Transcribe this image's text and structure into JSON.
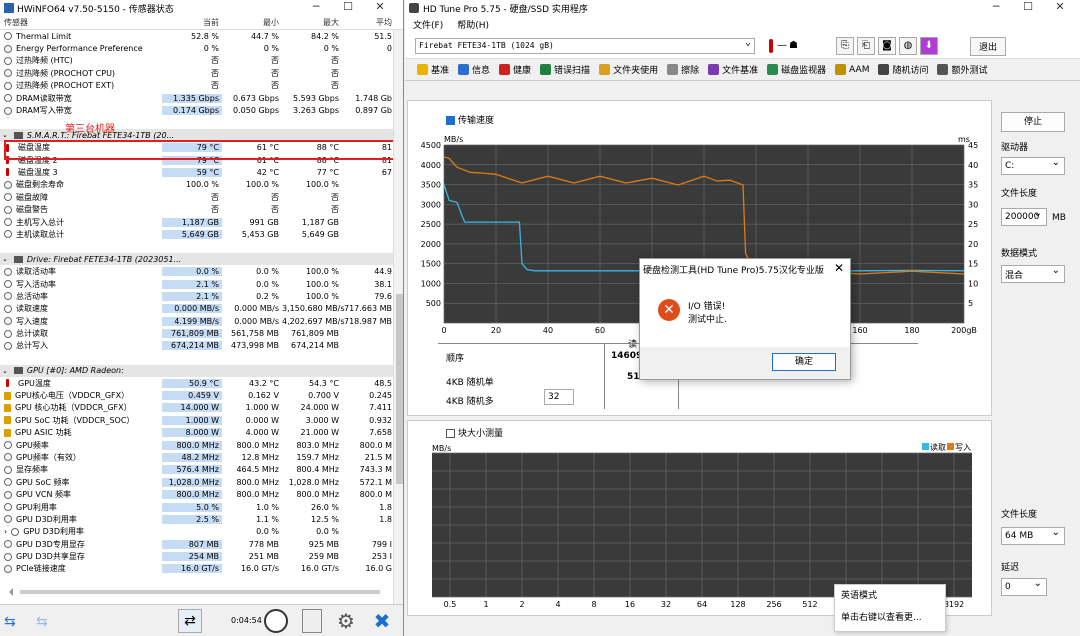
{
  "hwinfo": {
    "title": "HWiNFO64 v7.50-5150 - 传感器状态",
    "headers": [
      "传感器",
      "当前",
      "最小",
      "最大",
      "平均"
    ],
    "annotation": "第三台机器",
    "rows": [
      {
        "k": "r",
        "icon": "ic",
        "name": "Thermal Limit",
        "v": [
          "52.8 %",
          "44.7 %",
          "84.2 %",
          "51.5"
        ]
      },
      {
        "k": "r",
        "icon": "ic",
        "name": "Energy Performance Preference",
        "v": [
          "0 %",
          "0 %",
          "0 %",
          "0"
        ]
      },
      {
        "k": "r",
        "icon": "ic",
        "name": "过热降频 (HTC)",
        "v": [
          "否",
          "否",
          "否",
          ""
        ]
      },
      {
        "k": "r",
        "icon": "ic",
        "name": "过热降频 (PROCHOT CPU)",
        "v": [
          "否",
          "否",
          "否",
          ""
        ]
      },
      {
        "k": "r",
        "icon": "ic",
        "name": "过热降频 (PROCHOT EXT)",
        "v": [
          "否",
          "否",
          "否",
          ""
        ]
      },
      {
        "k": "r",
        "icon": "ic",
        "name": "DRAM读取带宽",
        "v": [
          "1.335 Gbps",
          "0.673 Gbps",
          "5.593 Gbps",
          "1.748 Gb"
        ],
        "hl": true
      },
      {
        "k": "r",
        "icon": "ic",
        "name": "DRAM写入带宽",
        "v": [
          "0.174 Gbps",
          "0.050 Gbps",
          "3.263 Gbps",
          "0.897 Gb"
        ],
        "hl": true
      },
      {
        "k": "s"
      },
      {
        "k": "g",
        "name": "S.M.A.R.T.: Firebat FETE34-1TB (20..."
      },
      {
        "k": "r",
        "icon": "t",
        "name": "磁盘温度",
        "v": [
          "79 °C",
          "61 °C",
          "88 °C",
          "81"
        ],
        "hl": true
      },
      {
        "k": "r",
        "icon": "t",
        "name": "磁盘温度 2",
        "v": [
          "79 °C",
          "61 °C",
          "88 °C",
          "81"
        ],
        "hl": true
      },
      {
        "k": "r",
        "icon": "t",
        "name": "磁盘温度 3",
        "v": [
          "59 °C",
          "42 °C",
          "77 °C",
          "67"
        ],
        "hl": true
      },
      {
        "k": "r",
        "icon": "ic",
        "name": "磁盘剩余寿命",
        "v": [
          "100.0 %",
          "100.0 %",
          "100.0 %",
          ""
        ]
      },
      {
        "k": "r",
        "icon": "ic",
        "name": "磁盘故障",
        "v": [
          "否",
          "否",
          "否",
          ""
        ]
      },
      {
        "k": "r",
        "icon": "ic",
        "name": "磁盘警告",
        "v": [
          "否",
          "否",
          "否",
          ""
        ]
      },
      {
        "k": "r",
        "icon": "ic",
        "name": "主机写入总计",
        "v": [
          "1,187 GB",
          "991 GB",
          "1,187 GB",
          ""
        ],
        "hl": true
      },
      {
        "k": "r",
        "icon": "ic",
        "name": "主机读取总计",
        "v": [
          "5,649 GB",
          "5,453 GB",
          "5,649 GB",
          ""
        ],
        "hl": true
      },
      {
        "k": "s"
      },
      {
        "k": "g",
        "name": "Drive: Firebat FETE34-1TB (2023051..."
      },
      {
        "k": "r",
        "icon": "ic",
        "name": "读取活动率",
        "v": [
          "0.0 %",
          "0.0 %",
          "100.0 %",
          "44.9"
        ],
        "hl": true
      },
      {
        "k": "r",
        "icon": "ic",
        "name": "写入活动率",
        "v": [
          "2.1 %",
          "0.0 %",
          "100.0 %",
          "38.1"
        ],
        "hl": true
      },
      {
        "k": "r",
        "icon": "ic",
        "name": "总活动率",
        "v": [
          "2.1 %",
          "0.2 %",
          "100.0 %",
          "79.6"
        ],
        "hl": true
      },
      {
        "k": "r",
        "icon": "ic",
        "name": "读取速度",
        "v": [
          "0.000 MB/s",
          "0.000 MB/s",
          "3,150.680 MB/s",
          "717.663 MB"
        ],
        "hl": true
      },
      {
        "k": "r",
        "icon": "ic",
        "name": "写入速度",
        "v": [
          "4.199 MB/s",
          "0.000 MB/s",
          "4,202.697 MB/s",
          "718.987 MB"
        ],
        "hl": true
      },
      {
        "k": "r",
        "icon": "ic",
        "name": "总计读取",
        "v": [
          "761,809 MB",
          "561,758 MB",
          "761,809 MB",
          ""
        ],
        "hl": true
      },
      {
        "k": "r",
        "icon": "ic",
        "name": "总计写入",
        "v": [
          "674,214 MB",
          "473,998 MB",
          "674,214 MB",
          ""
        ],
        "hl": true
      },
      {
        "k": "s"
      },
      {
        "k": "g",
        "name": "GPU [#0]: AMD Radeon:"
      },
      {
        "k": "r",
        "icon": "t",
        "name": "GPU温度",
        "v": [
          "50.9 °C",
          "43.2 °C",
          "54.3 °C",
          "48.5"
        ],
        "hl": true
      },
      {
        "k": "r",
        "icon": "g",
        "name": "GPU核心电压（VDDCR_GFX）",
        "v": [
          "0.459 V",
          "0.162 V",
          "0.700 V",
          "0.245"
        ],
        "hl": true
      },
      {
        "k": "r",
        "icon": "g",
        "name": "GPU 核心功耗（VDDCR_GFX）",
        "v": [
          "14.000 W",
          "1.000 W",
          "24.000 W",
          "7.411"
        ],
        "hl": true
      },
      {
        "k": "r",
        "icon": "g",
        "name": "GPU SoC 功耗（VDDCR_SOC）",
        "v": [
          "1.000 W",
          "0.000 W",
          "3.000 W",
          "0.932"
        ],
        "hl": true
      },
      {
        "k": "r",
        "icon": "g",
        "name": "GPU ASIC 功耗",
        "v": [
          "8.000 W",
          "4.000 W",
          "21.000 W",
          "7.658"
        ],
        "hl": true
      },
      {
        "k": "r",
        "icon": "ic",
        "name": "GPU频率",
        "v": [
          "800.0 MHz",
          "800.0 MHz",
          "803.0 MHz",
          "800.0 M"
        ],
        "hl": true
      },
      {
        "k": "r",
        "icon": "ic",
        "name": "GPU频率（有效）",
        "v": [
          "48.2 MHz",
          "12.8 MHz",
          "159.7 MHz",
          "21.5 M"
        ],
        "hl": true
      },
      {
        "k": "r",
        "icon": "ic",
        "name": "显存频率",
        "v": [
          "576.4 MHz",
          "464.5 MHz",
          "800.4 MHz",
          "743.3 M"
        ],
        "hl": true
      },
      {
        "k": "r",
        "icon": "ic",
        "name": "GPU SoC 频率",
        "v": [
          "1,028.0 MHz",
          "800.0 MHz",
          "1,028.0 MHz",
          "572.1 M"
        ],
        "hl": true
      },
      {
        "k": "r",
        "icon": "ic",
        "name": "GPU VCN 频率",
        "v": [
          "800.0 MHz",
          "800.0 MHz",
          "800.0 MHz",
          "800.0 M"
        ],
        "hl": true
      },
      {
        "k": "r",
        "icon": "ic",
        "name": "GPU利用率",
        "v": [
          "5.0 %",
          "1.0 %",
          "26.0 %",
          "1.8"
        ],
        "hl": true
      },
      {
        "k": "r",
        "icon": "ic",
        "name": "GPU D3D利用率",
        "v": [
          "2.5 %",
          "1.1 %",
          "12.5 %",
          "1.8"
        ],
        "hl": true
      },
      {
        "k": "r",
        "icon": "ic",
        "name": "GPU D3D利用率",
        "v": [
          "",
          "0.0 %",
          "0.0 %",
          ""
        ],
        "exp": true
      },
      {
        "k": "r",
        "icon": "ic",
        "name": "GPU D3D专用显存",
        "v": [
          "807 MB",
          "778 MB",
          "925 MB",
          "799 I"
        ],
        "hl": true
      },
      {
        "k": "r",
        "icon": "ic",
        "name": "GPU D3D共享显存",
        "v": [
          "254 MB",
          "251 MB",
          "259 MB",
          "253 I"
        ],
        "hl": true
      },
      {
        "k": "r",
        "icon": "ic",
        "name": "PCIe链接速度",
        "v": [
          "16.0 GT/s",
          "16.0 GT/s",
          "16.0 GT/s",
          "16.0 G"
        ],
        "hl": true
      }
    ],
    "timer": "0:04:54"
  },
  "hdtune": {
    "title": "HD Tune Pro 5.75 - 硬盘/SSD 实用程序",
    "menu": [
      "文件(F)",
      "帮助(H)"
    ],
    "drive": "Firebat FETE34-1TB (1024 gB)",
    "temp": "—",
    "exit": "退出",
    "tabs": [
      "基准",
      "信息",
      "健康",
      "错误扫描",
      "文件夹使用",
      "擦除",
      "文件基准",
      "磁盘监视器",
      "AAM",
      "随机访问",
      "额外测试"
    ],
    "transfer_check": "传输速度",
    "stop": "停止",
    "drive_label": "驱动器",
    "drive_value": "C:",
    "file_len_label": "文件长度",
    "file_len_value": "200000",
    "file_len_unit": "MB",
    "data_mode_label": "数据模式",
    "data_mode_value": "混合",
    "result_labels": [
      "顺序",
      "4KB 随机单",
      "4KB 随机多"
    ],
    "result_vals": [
      "146094",
      "510"
    ],
    "read_hdr": "读",
    "qd": "32",
    "block_check": "块大小测量",
    "file_len2_label": "文件长度",
    "file_len2_value": "64 MB",
    "delay_label": "延迟",
    "delay_value": "0",
    "legend_read": "读取",
    "legend_write": "写入"
  },
  "chart_data": [
    {
      "type": "line",
      "title": "",
      "xlabel": "",
      "ylabel": "MB/s",
      "y2label": "ms",
      "xlim": [
        0,
        200
      ],
      "ylim": [
        0,
        4500
      ],
      "y2lim": [
        0,
        45
      ],
      "xticks": [
        "0",
        "20",
        "40",
        "60",
        "80",
        "100",
        "120",
        "140",
        "160",
        "180",
        "200gB"
      ],
      "yticks": [
        "4500",
        "4000",
        "3500",
        "3000",
        "2500",
        "2000",
        "1500",
        "1000",
        "500"
      ],
      "y2ticks": [
        "45",
        "40",
        "35",
        "30",
        "25",
        "20",
        "15",
        "10",
        "5"
      ],
      "series": [
        {
          "name": "读取",
          "x": [
            0,
            1,
            2,
            5,
            7,
            8,
            10,
            12,
            15,
            20,
            25,
            28,
            29,
            30,
            32,
            35,
            40,
            50,
            60,
            80,
            100,
            120,
            140,
            160,
            180,
            200
          ],
          "y": [
            3500,
            3300,
            3100,
            3050,
            2700,
            2550,
            2550,
            2550,
            2550,
            2550,
            2550,
            2550,
            2550,
            1500,
            1350,
            1320,
            1320,
            1320,
            1320,
            1320,
            1320,
            1330,
            1320,
            1320,
            1330,
            1320
          ]
        },
        {
          "name": "写入",
          "x": [
            0,
            2,
            5,
            10,
            15,
            20,
            30,
            40,
            50,
            60,
            70,
            80,
            90,
            100,
            105,
            110,
            115,
            116,
            120,
            140,
            160,
            180,
            200
          ],
          "y": [
            4200,
            4100,
            4000,
            3750,
            3850,
            3700,
            3600,
            3650,
            3600,
            3650,
            3600,
            3600,
            3550,
            3650,
            3650,
            3550,
            3550,
            1700,
            1300,
            1250,
            1300,
            1250,
            1300
          ]
        }
      ]
    },
    {
      "type": "line",
      "title": "",
      "ylabel": "MB/s",
      "xticks": [
        "0.5",
        "1",
        "2",
        "4",
        "8",
        "16",
        "32",
        "64",
        "128",
        "256",
        "512",
        "1024",
        "2048",
        "4096",
        "8192"
      ],
      "series": [
        {
          "name": "读取",
          "values": []
        },
        {
          "name": "写入",
          "values": []
        }
      ]
    }
  ],
  "dialog": {
    "title": "硬盘检测工具(HD Tune Pro)5.75汉化专业版",
    "msg1": "I/O 错误!",
    "msg2": "测试中止.",
    "ok": "确定"
  },
  "context_menu": [
    "英语模式",
    "单击右键以查看更..."
  ]
}
